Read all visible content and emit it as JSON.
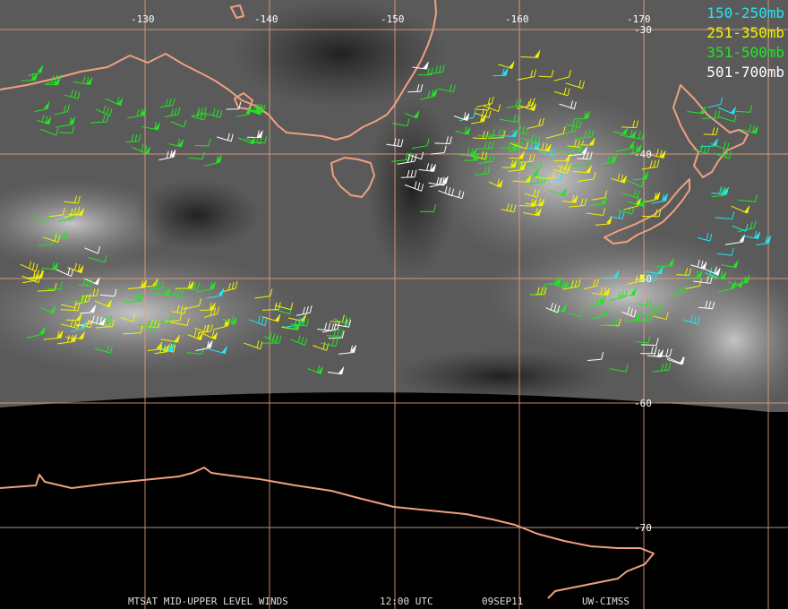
{
  "footer": {
    "product": "MTSAT MID-UPPER LEVEL WINDS",
    "time": "12:00 UTC",
    "date": "09SEP11",
    "credit": "UW-CIMSS"
  },
  "legend": [
    {
      "label": "150-250mb",
      "color": "#22e6f0"
    },
    {
      "label": "251-350mb",
      "color": "#f2f200"
    },
    {
      "label": "351-500mb",
      "color": "#22e622"
    },
    {
      "label": "501-700mb",
      "color": "#ffffff"
    }
  ],
  "longitude_labels": [
    "-130",
    "-140",
    "-150",
    "-160",
    "-170"
  ],
  "latitude_labels": [
    "-30",
    "-40",
    "-50",
    "-60",
    "-70"
  ],
  "colors": {
    "coastline": "#f0a080",
    "gridline": "#e8a080",
    "night_side": "#000000"
  }
}
